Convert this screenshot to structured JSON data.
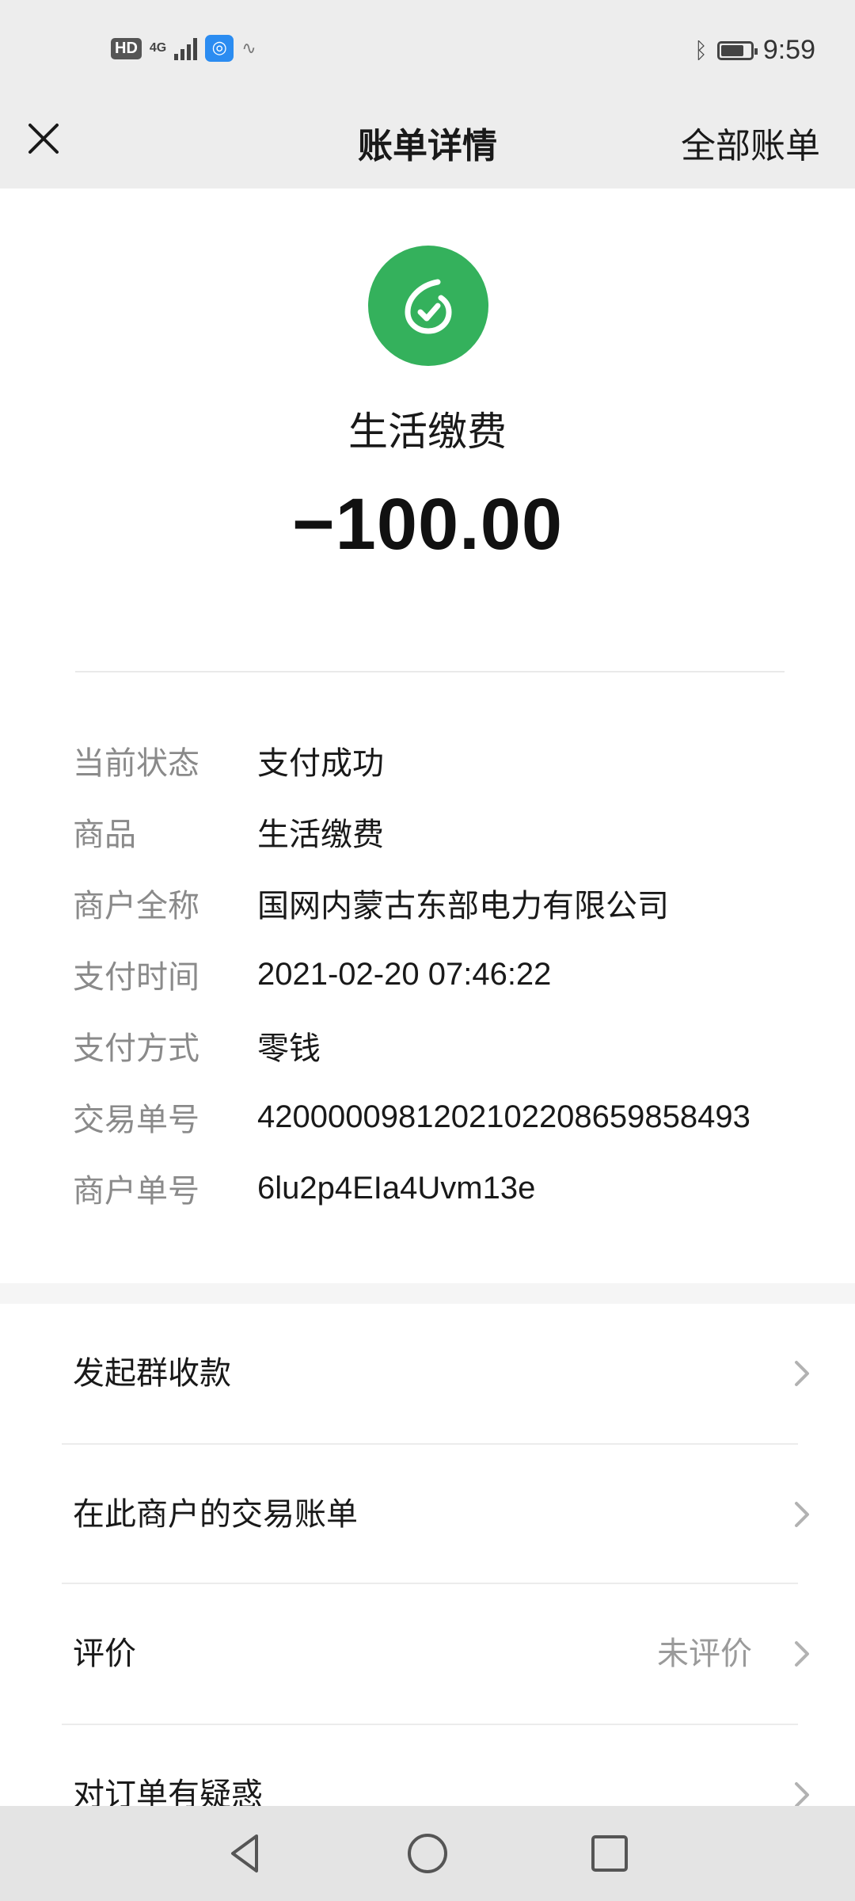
{
  "status_bar": {
    "hd": "HD",
    "network": "4G",
    "time": "9:59",
    "icons": [
      "hd-icon",
      "signal-icon",
      "app-notification-icon",
      "bluetooth-icon",
      "battery-icon"
    ]
  },
  "nav": {
    "title": "账单详情",
    "all_bills": "全部账单",
    "close_icon": "close-icon"
  },
  "header": {
    "merchant_name": "生活缴费",
    "amount": "−100.00",
    "logo_color": "#34b15c"
  },
  "details": [
    {
      "label": "当前状态",
      "value": "支付成功"
    },
    {
      "label": "商品",
      "value": "生活缴费"
    },
    {
      "label": "商户全称",
      "value": "国网内蒙古东部电力有限公司"
    },
    {
      "label": "支付时间",
      "value": "2021-02-20 07:46:22"
    },
    {
      "label": "支付方式",
      "value": "零钱"
    },
    {
      "label": "交易单号",
      "value": "4200000981202102208659858493"
    },
    {
      "label": "商户单号",
      "value": "6lu2p4EIa4Uvm13e"
    }
  ],
  "menu": [
    {
      "label": "发起群收款",
      "sub": ""
    },
    {
      "label": "在此商户的交易账单",
      "sub": ""
    },
    {
      "label": "评价",
      "sub": "未评价"
    },
    {
      "label": "对订单有疑惑",
      "sub": ""
    }
  ],
  "android_nav": [
    "back-icon",
    "home-icon",
    "recents-icon"
  ]
}
